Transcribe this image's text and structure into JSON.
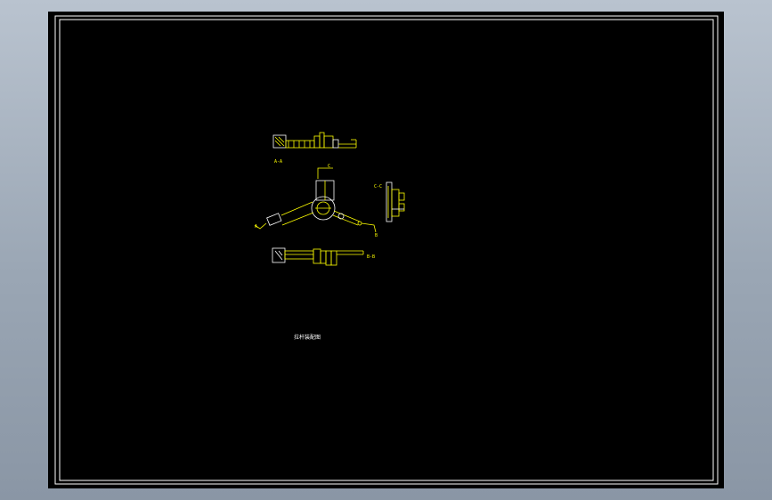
{
  "drawing": {
    "colors": {
      "background": "#000000",
      "frame": "#ffffff",
      "geometry": "#ffff00",
      "outline": "#ffffff"
    },
    "labels": {
      "section_a_a": "A-A",
      "section_b_b": "B-B",
      "section_c_c": "C-C",
      "cut_a": "A",
      "cut_b": "B",
      "cut_c": "C",
      "title": "拉杆装配图"
    }
  }
}
